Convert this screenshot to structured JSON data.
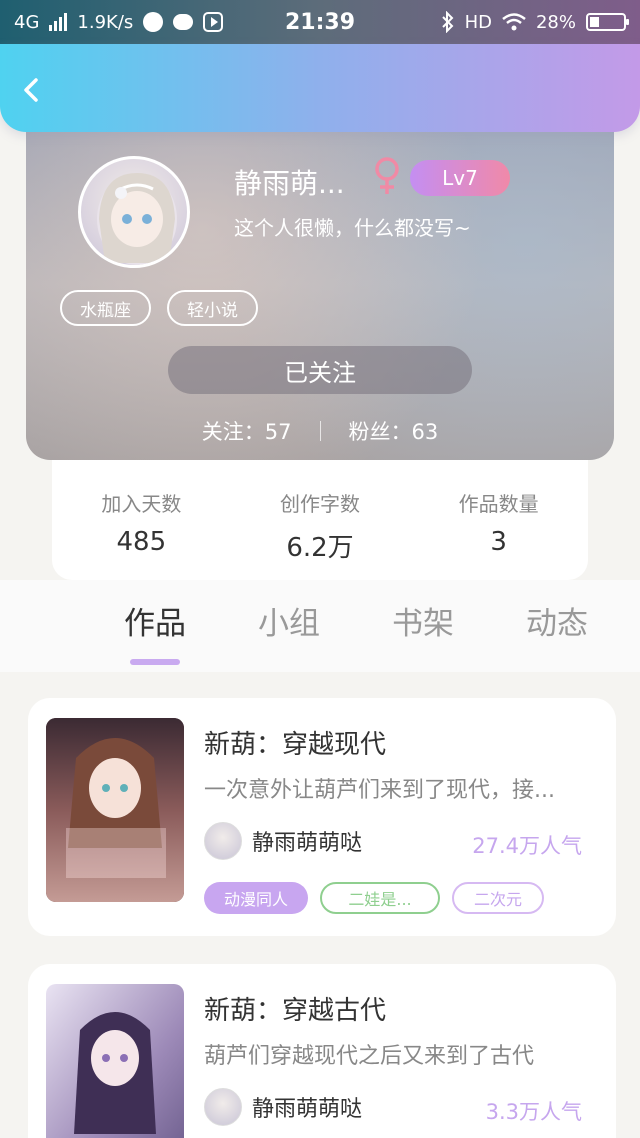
{
  "status_bar": {
    "network": "4G",
    "speed": "1.9K/s",
    "time": "21:39",
    "hd": "HD",
    "battery": "28%",
    "battery_level": 0.28
  },
  "header": {
    "back_icon": "chevron-left-icon"
  },
  "profile": {
    "nickname": "静雨萌...",
    "gender_icon": "female-icon",
    "level": "Lv7",
    "bio": "这个人很懒，什么都没写~",
    "tags": [
      "水瓶座",
      "轻小说"
    ],
    "follow_button": "已关注",
    "following_label": "关注：",
    "following_count": "57",
    "fans_label": "粉丝：",
    "fans_count": "63"
  },
  "stats": [
    {
      "label": "加入天数",
      "value": "485"
    },
    {
      "label": "创作字数",
      "value": "6.2万"
    },
    {
      "label": "作品数量",
      "value": "3"
    }
  ],
  "tabs": [
    "作品",
    "小组",
    "书架",
    "动态"
  ],
  "works": [
    {
      "title": "新葫：穿越现代",
      "description": "一次意外让葫芦们来到了现代，接...",
      "author": "静雨萌萌哒",
      "popularity": "27.4万人气",
      "tags": [
        "动漫同人",
        "二娃是...",
        "二次元"
      ]
    },
    {
      "title": "新葫：穿越古代",
      "description": "葫芦们穿越现代之后又来到了古代",
      "author": "静雨萌萌哒",
      "popularity": "3.3万人气"
    }
  ],
  "colors": {
    "accent_purple": "#c8a6f0",
    "green_tag": "#8fcf8f",
    "header_start": "#4fd2f0",
    "header_end": "#c39ae8"
  }
}
